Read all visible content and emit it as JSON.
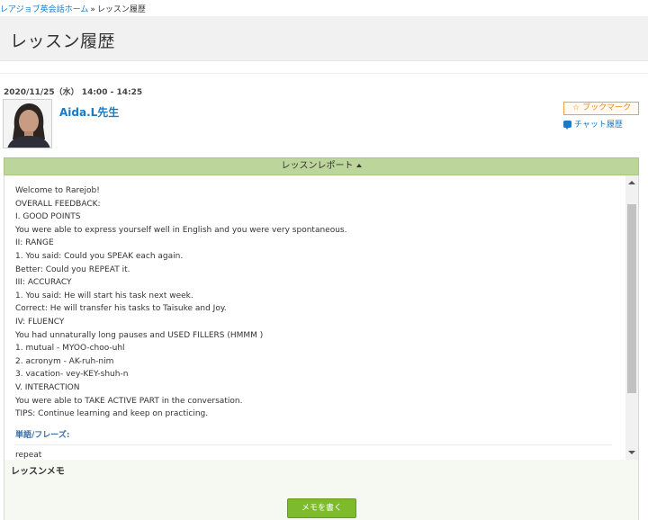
{
  "breadcrumb": {
    "home_link": "レアジョブ英会話ホーム",
    "separator": "»",
    "current": "レッスン履歴"
  },
  "page_title": "レッスン履歴",
  "lesson": {
    "datetime": "2020/11/25（水） 14:00 - 14:25",
    "tutor_name": "Aida.L先生",
    "avatar_icon": "tutor-photo",
    "bookmark_label": "ブックマーク",
    "chat_history_label": "チャット履歴"
  },
  "report": {
    "header_label": "レッスンレポート",
    "lines": [
      "Welcome to Rarejob!",
      "OVERALL FEEDBACK:",
      "I. GOOD POINTS",
      "You were able to express yourself well in English and you were very spontaneous.",
      "II: RANGE",
      "1. You said: Could you SPEAK each again.",
      "Better: Could you REPEAT it.",
      "III: ACCURACY",
      "1. You said: He will start his task next week.",
      "Correct: He will transfer his tasks to Taisuke and Joy.",
      "IV: FLUENCY",
      "You had unnaturally long pauses and USED FILLERS (HMMM )",
      "1. mutual - MYOO-choo-uhl",
      "2. acronym - AK-ruh-nim",
      "3. vacation- vey-KEY-shuh-n",
      "V. INTERACTION",
      "You were able to TAKE ACTIVE PART in the conversation.",
      "TIPS: Continue learning and keep on practicing."
    ],
    "phrases_heading": "単語/フレーズ:",
    "phrases": [
      "repeat"
    ]
  },
  "memo": {
    "title": "レッスンメモ",
    "write_button": "メモを書く"
  },
  "colors": {
    "link": "#1a7ac6",
    "report_header_bg": "#bcd59a",
    "memo_button": "#7dbb2c",
    "bookmark_border": "#f0a04b"
  }
}
